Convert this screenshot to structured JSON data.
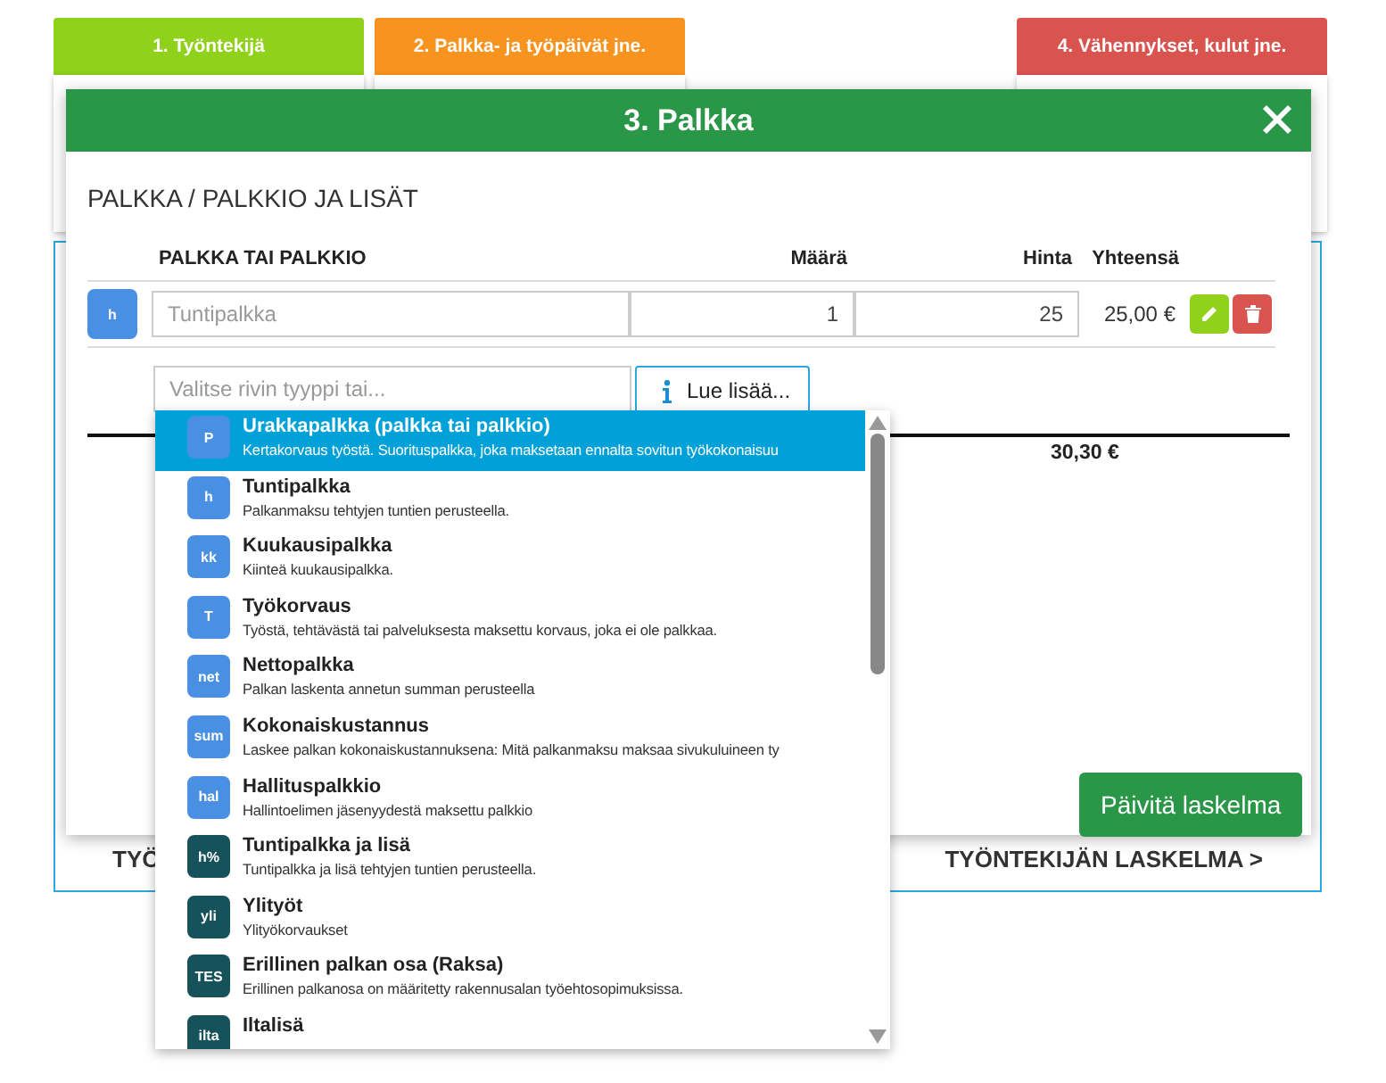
{
  "steps": [
    {
      "label": "1. Työntekijä",
      "color": "#8fd11b"
    },
    {
      "label": "2. Palkka- ja työpäivät jne.",
      "color": "#f7931e"
    },
    {
      "label": "4. Vähennykset, kulut jne.",
      "color": "#d9534f"
    }
  ],
  "background_panel": {
    "left_link": "TYÖ",
    "right_link": "TYÖNTEKIJÄN LASKELMA >"
  },
  "modal": {
    "title": "3. Palkka",
    "section_title": "PALKKA / PALKKIO JA LISÄT",
    "columns": [
      "PALKKA TAI PALKKIO",
      "Määrä",
      "Hinta",
      "Yhteensä"
    ],
    "rows": [
      {
        "badge": "h",
        "color": "#4a90e2",
        "name_placeholder": "Tuntipalkka",
        "quantity": "1",
        "price": "25",
        "total": "25,00 €"
      }
    ],
    "new_row": {
      "placeholder": "Valitse rivin tyyppi tai...",
      "info_button": "Lue lisää..."
    },
    "grand_total": "30,30 €"
  },
  "dropdown": {
    "items": [
      {
        "badge": "P",
        "color": "#4a90e2",
        "title": "Urakkapalkka (palkka tai palkkio)",
        "description": "Kertakorvaus työstä. Suorituspalkka, joka maksetaan ennalta sovitun työkokonaisuu",
        "selected": true
      },
      {
        "badge": "h",
        "color": "#4a90e2",
        "title": "Tuntipalkka",
        "description": "Palkanmaksu tehtyjen tuntien perusteella.",
        "selected": false
      },
      {
        "badge": "kk",
        "color": "#4a90e2",
        "title": "Kuukausipalkka",
        "description": "Kiinteä kuukausipalkka.",
        "selected": false
      },
      {
        "badge": "T",
        "color": "#4a90e2",
        "title": "Työkorvaus",
        "description": "Työstä, tehtävästä tai palveluksesta maksettu korvaus, joka ei ole palkkaa.",
        "selected": false
      },
      {
        "badge": "net",
        "color": "#4a90e2",
        "title": "Nettopalkka",
        "description": "Palkan laskenta annetun summan perusteella",
        "selected": false
      },
      {
        "badge": "sum",
        "color": "#4a90e2",
        "title": "Kokonaiskustannus",
        "description": "Laskee palkan kokonaiskustannuksena: Mitä palkanmaksu maksaa sivukuluineen ty",
        "selected": false
      },
      {
        "badge": "hal",
        "color": "#4a90e2",
        "title": "Hallituspalkkio",
        "description": "Hallintoelimen jäsenyydestä maksettu palkkio",
        "selected": false
      },
      {
        "badge": "h%",
        "color": "#16525a",
        "title": "Tuntipalkka ja lisä",
        "description": "Tuntipalkka ja lisä tehtyjen tuntien perusteella.",
        "selected": false
      },
      {
        "badge": "yli",
        "color": "#16525a",
        "title": "Ylityöt",
        "description": "Ylityökorvaukset",
        "selected": false
      },
      {
        "badge": "TES",
        "color": "#16525a",
        "title": "Erillinen palkan osa (Raksa)",
        "description": "Erillinen palkanosa on määritetty rakennusalan työehtosopimuksissa.",
        "selected": false
      },
      {
        "badge": "ilta",
        "color": "#16525a",
        "title": "Iltalisä",
        "selected": false
      }
    ]
  },
  "update_button": "Päivitä laskelma"
}
